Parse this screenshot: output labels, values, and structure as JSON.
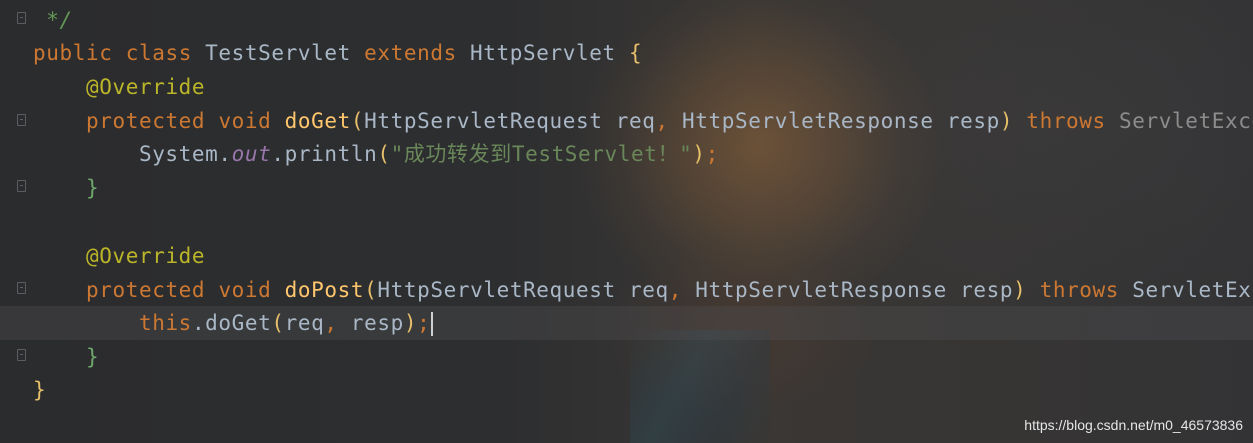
{
  "editor": {
    "lines": [
      {
        "segments": [
          {
            "cls": "cmt",
            "text": " */"
          }
        ]
      },
      {
        "segments": [
          {
            "cls": "kw",
            "text": "public"
          },
          {
            "cls": "",
            "text": " "
          },
          {
            "cls": "kw",
            "text": "class"
          },
          {
            "cls": "",
            "text": " TestServlet "
          },
          {
            "cls": "kw",
            "text": "extends"
          },
          {
            "cls": "",
            "text": " HttpServlet "
          },
          {
            "cls": "brace-y",
            "text": "{"
          }
        ]
      },
      {
        "segments": [
          {
            "cls": "",
            "text": "    "
          },
          {
            "cls": "ann",
            "text": "@Override"
          }
        ]
      },
      {
        "segments": [
          {
            "cls": "",
            "text": "    "
          },
          {
            "cls": "kw",
            "text": "protected"
          },
          {
            "cls": "",
            "text": " "
          },
          {
            "cls": "kw",
            "text": "void"
          },
          {
            "cls": "",
            "text": " "
          },
          {
            "cls": "fn",
            "text": "doGet"
          },
          {
            "cls": "brace-y",
            "text": "("
          },
          {
            "cls": "",
            "text": "HttpServletRequest req"
          },
          {
            "cls": "kw",
            "text": ","
          },
          {
            "cls": "",
            "text": " HttpServletResponse resp"
          },
          {
            "cls": "brace-y",
            "text": ")"
          },
          {
            "cls": "",
            "text": " "
          },
          {
            "cls": "kw",
            "text": "throws"
          },
          {
            "cls": "dim",
            "text": " ServletExcep"
          }
        ]
      },
      {
        "segments": [
          {
            "cls": "",
            "text": "        System."
          },
          {
            "cls": "fld",
            "text": "out"
          },
          {
            "cls": "",
            "text": ".println"
          },
          {
            "cls": "brace-y",
            "text": "("
          },
          {
            "cls": "str",
            "text": "\"成功转发到TestServlet！\""
          },
          {
            "cls": "brace-y",
            "text": ")"
          },
          {
            "cls": "kw",
            "text": ";"
          }
        ]
      },
      {
        "segments": [
          {
            "cls": "",
            "text": "    "
          },
          {
            "cls": "brace-g",
            "text": "}"
          }
        ]
      },
      {
        "segments": [
          {
            "cls": "",
            "text": ""
          }
        ]
      },
      {
        "segments": [
          {
            "cls": "",
            "text": "    "
          },
          {
            "cls": "ann",
            "text": "@Override"
          }
        ]
      },
      {
        "segments": [
          {
            "cls": "",
            "text": "    "
          },
          {
            "cls": "kw",
            "text": "protected"
          },
          {
            "cls": "",
            "text": " "
          },
          {
            "cls": "kw",
            "text": "void"
          },
          {
            "cls": "",
            "text": " "
          },
          {
            "cls": "fn",
            "text": "doPost"
          },
          {
            "cls": "brace-y",
            "text": "("
          },
          {
            "cls": "",
            "text": "HttpServletRequest req"
          },
          {
            "cls": "kw",
            "text": ","
          },
          {
            "cls": "",
            "text": " HttpServletResponse resp"
          },
          {
            "cls": "brace-y",
            "text": ")"
          },
          {
            "cls": "",
            "text": " "
          },
          {
            "cls": "kw",
            "text": "throws"
          },
          {
            "cls": "",
            "text": " ServletExce"
          }
        ]
      },
      {
        "current": true,
        "caret": true,
        "segments": [
          {
            "cls": "",
            "text": "        "
          },
          {
            "cls": "kw",
            "text": "this"
          },
          {
            "cls": "",
            "text": ".doGet"
          },
          {
            "cls": "brace-y",
            "text": "("
          },
          {
            "cls": "",
            "text": "req"
          },
          {
            "cls": "kw",
            "text": ","
          },
          {
            "cls": "",
            "text": " resp"
          },
          {
            "cls": "brace-y",
            "text": ")"
          },
          {
            "cls": "kw",
            "text": ";"
          }
        ]
      },
      {
        "segments": [
          {
            "cls": "",
            "text": "    "
          },
          {
            "cls": "brace-g",
            "text": "}"
          }
        ]
      },
      {
        "segments": [
          {
            "cls": "brace-y",
            "text": "}"
          }
        ]
      }
    ]
  },
  "watermark": "https://blog.csdn.net/m0_46573836",
  "colors": {
    "keyword": "#cc7832",
    "annotation": "#bbb529",
    "method": "#ffc66d",
    "string": "#6a8759",
    "field": "#9876aa",
    "plain": "#a9b7c6"
  }
}
